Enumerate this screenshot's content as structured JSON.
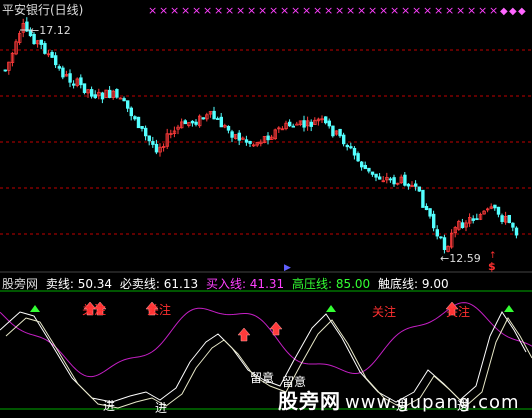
{
  "title": "平安银行(日线)",
  "price_labels": {
    "high": "17.12",
    "low": "12.59"
  },
  "red_s": "$",
  "indicator_legend": {
    "name": "股旁网",
    "sell_line": "卖线: 50.34",
    "must_sell_line": "必卖线: 61.13",
    "buy_line": "买入线: 41.31",
    "high_pressure_line": "高压线: 85.00",
    "bottom_line": "触底线: 9.00"
  },
  "signal_labels": {
    "attention": "关注",
    "enter": "进",
    "caution": "留意"
  },
  "watermark": {
    "cn": "股旁网",
    "url": "www.gupang.com"
  },
  "colors": {
    "up": "#ff3b3b",
    "down": "#54ffff",
    "cross_mark": "#ff40ff",
    "magenta_line": "#c41fc4",
    "white_line": "#ffffff",
    "grid": "#c00000",
    "sep": "#00aa00",
    "buy_legend": "#ff40ff",
    "high_legend": "#33ff33"
  }
}
